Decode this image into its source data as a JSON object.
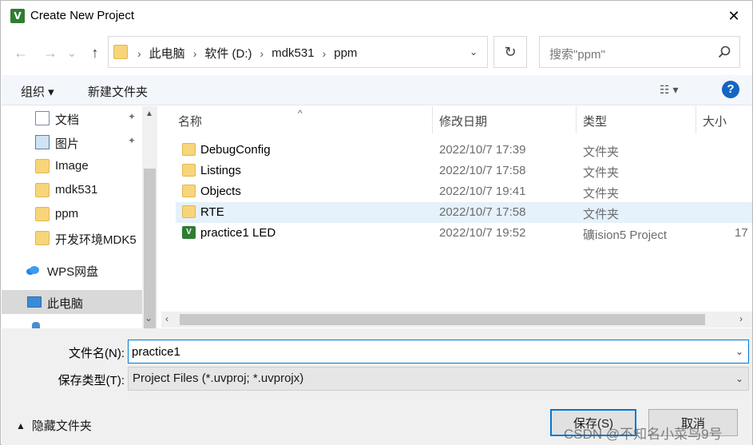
{
  "window": {
    "app_icon_text": "V",
    "title": "Create New Project",
    "close_symbol": "✕"
  },
  "nav": {
    "back": "←",
    "forward": "→",
    "recent": "⌄",
    "up": "↑"
  },
  "address": {
    "crumbs": [
      "此电脑",
      "软件 (D:)",
      "mdk531",
      "ppm"
    ],
    "separator": "›",
    "dropdown": "⌄",
    "refresh": "↻"
  },
  "search": {
    "placeholder": "搜索\"ppm\""
  },
  "toolbar": {
    "organize": "组织 ▾",
    "new_folder": "新建文件夹",
    "view": "☷ ▾",
    "help": "?"
  },
  "sidebar": {
    "items": [
      {
        "label": "文档",
        "icon": "document-icon",
        "pinned": true
      },
      {
        "label": "图片",
        "icon": "picture-icon",
        "pinned": true
      },
      {
        "label": "Image",
        "icon": "folder-icon"
      },
      {
        "label": "mdk531",
        "icon": "folder-icon"
      },
      {
        "label": "ppm",
        "icon": "folder-icon"
      },
      {
        "label": "开发环境MDK5",
        "icon": "folder-icon"
      },
      {
        "label": "WPS网盘",
        "icon": "cloud-icon"
      },
      {
        "label": "此电脑",
        "icon": "computer-icon",
        "selected": true
      }
    ],
    "pin_symbol": "📌"
  },
  "list": {
    "columns": [
      "名称",
      "修改日期",
      "类型",
      "大小"
    ],
    "sort_caret": "^",
    "rows": [
      {
        "name": "DebugConfig",
        "date": "2022/10/7 17:39",
        "type": "文件夹",
        "size": "",
        "icon": "folder-icon"
      },
      {
        "name": "Listings",
        "date": "2022/10/7 17:58",
        "type": "文件夹",
        "size": "",
        "icon": "folder-icon"
      },
      {
        "name": "Objects",
        "date": "2022/10/7 19:41",
        "type": "文件夹",
        "size": "",
        "icon": "folder-icon"
      },
      {
        "name": "RTE",
        "date": "2022/10/7 17:58",
        "type": "文件夹",
        "size": "",
        "icon": "folder-icon",
        "highlighted": true
      },
      {
        "name": "practice1 LED",
        "date": "2022/10/7 19:52",
        "type": "礦ision5 Project",
        "size": "17",
        "icon": "uvision-icon"
      }
    ]
  },
  "form": {
    "filename_label": "文件名(N):",
    "filename_value": "practice1",
    "filetype_label": "保存类型(T):",
    "filetype_value": "Project Files (*.uvproj; *.uvprojx)",
    "hide_folders": "隐藏文件夹",
    "save": "保存(S)",
    "cancel": "取消"
  },
  "watermark": "CSDN @不知名小菜鸟9号",
  "colors": {
    "accent": "#0078d7",
    "folder": "#f7d57b",
    "selection": "#e5f1fb",
    "help": "#1565c0"
  }
}
